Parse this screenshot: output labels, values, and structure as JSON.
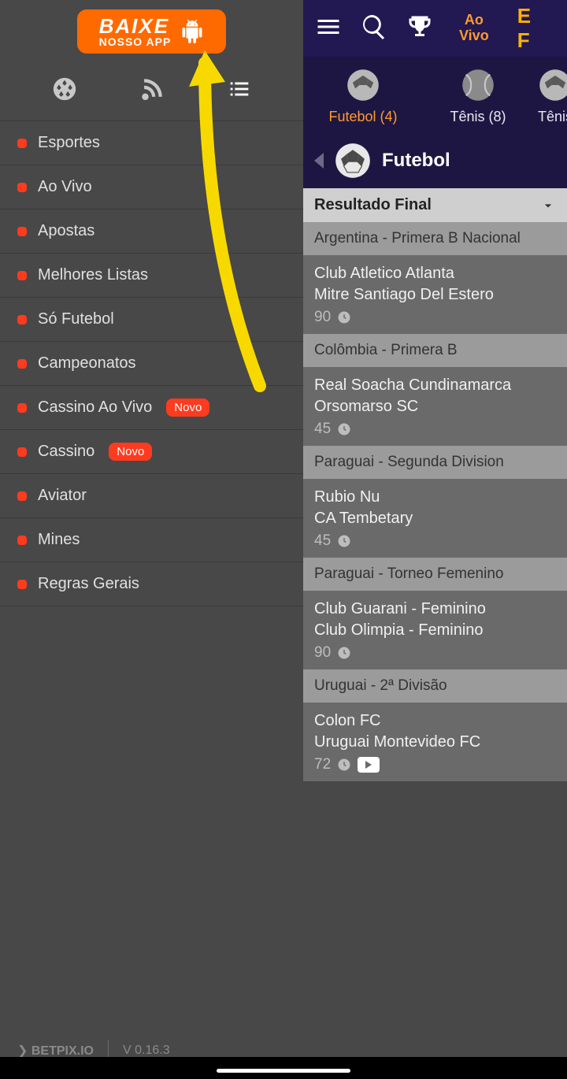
{
  "sidebar": {
    "download": {
      "line1": "BAIXE",
      "line2": "NOSSO APP"
    },
    "items": [
      {
        "label": "Esportes",
        "badge": null
      },
      {
        "label": "Ao Vivo",
        "badge": null
      },
      {
        "label": "Apostas",
        "badge": null
      },
      {
        "label": "Melhores Listas",
        "badge": null
      },
      {
        "label": "Só Futebol",
        "badge": null
      },
      {
        "label": "Campeonatos",
        "badge": null
      },
      {
        "label": "Cassino Ao Vivo",
        "badge": "Novo"
      },
      {
        "label": "Cassino",
        "badge": "Novo"
      },
      {
        "label": "Aviator",
        "badge": null
      },
      {
        "label": "Mines",
        "badge": null
      },
      {
        "label": "Regras Gerais",
        "badge": null
      }
    ],
    "footer": {
      "brand": "BETPIX.IO",
      "version": "V 0.16.3"
    }
  },
  "header": {
    "live_line1": "Ao",
    "live_line2": "Vivo"
  },
  "sport_tabs": [
    {
      "label": "Futebol (4)",
      "active": true,
      "icon": "soccer"
    },
    {
      "label": "Tênis (8)",
      "active": false,
      "icon": "tennis"
    },
    {
      "label": "Tênis",
      "active": false,
      "icon": "cut"
    }
  ],
  "section": {
    "title": "Futebol"
  },
  "result_header": "Resultado Final",
  "leagues": [
    {
      "name": "Argentina - Primera B Nacional",
      "matches": [
        {
          "home": "Club Atletico Atlanta",
          "away": "Mitre Santiago Del Estero",
          "minute": "90",
          "video": false
        }
      ]
    },
    {
      "name": "Colômbia - Primera B",
      "matches": [
        {
          "home": "Real Soacha Cundinamarca",
          "away": "Orsomarso SC",
          "minute": "45",
          "video": false
        }
      ]
    },
    {
      "name": "Paraguai - Segunda Division",
      "matches": [
        {
          "home": "Rubio Nu",
          "away": "CA Tembetary",
          "minute": "45",
          "video": false
        }
      ]
    },
    {
      "name": "Paraguai - Torneo Femenino",
      "matches": [
        {
          "home": "Club Guarani - Feminino",
          "away": "Club Olimpia - Feminino",
          "minute": "90",
          "video": false
        }
      ]
    },
    {
      "name": "Uruguai - 2ª Divisão",
      "matches": [
        {
          "home": "Colon FC",
          "away": "Uruguai Montevideo FC",
          "minute": "72",
          "video": true
        }
      ]
    }
  ]
}
